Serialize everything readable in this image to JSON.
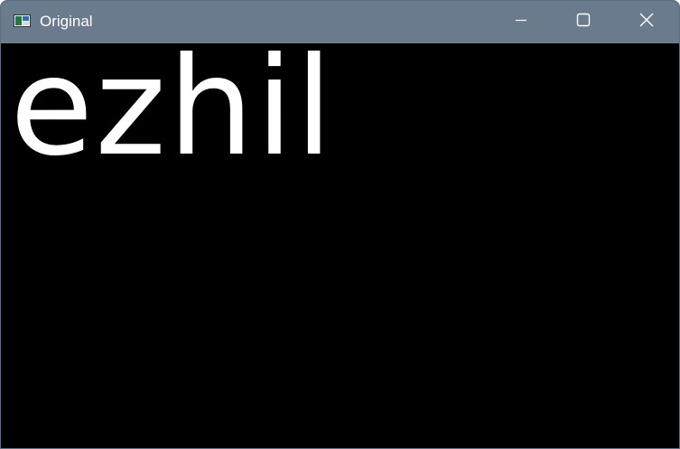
{
  "window": {
    "title": "Original",
    "controls": {
      "minimize": "minimize-icon",
      "maximize": "maximize-icon",
      "close": "close-icon"
    },
    "colors": {
      "titlebar": "#6a7b8d",
      "background": "#000000",
      "text": "#ffffff"
    }
  },
  "image": {
    "text": "ezhil"
  }
}
